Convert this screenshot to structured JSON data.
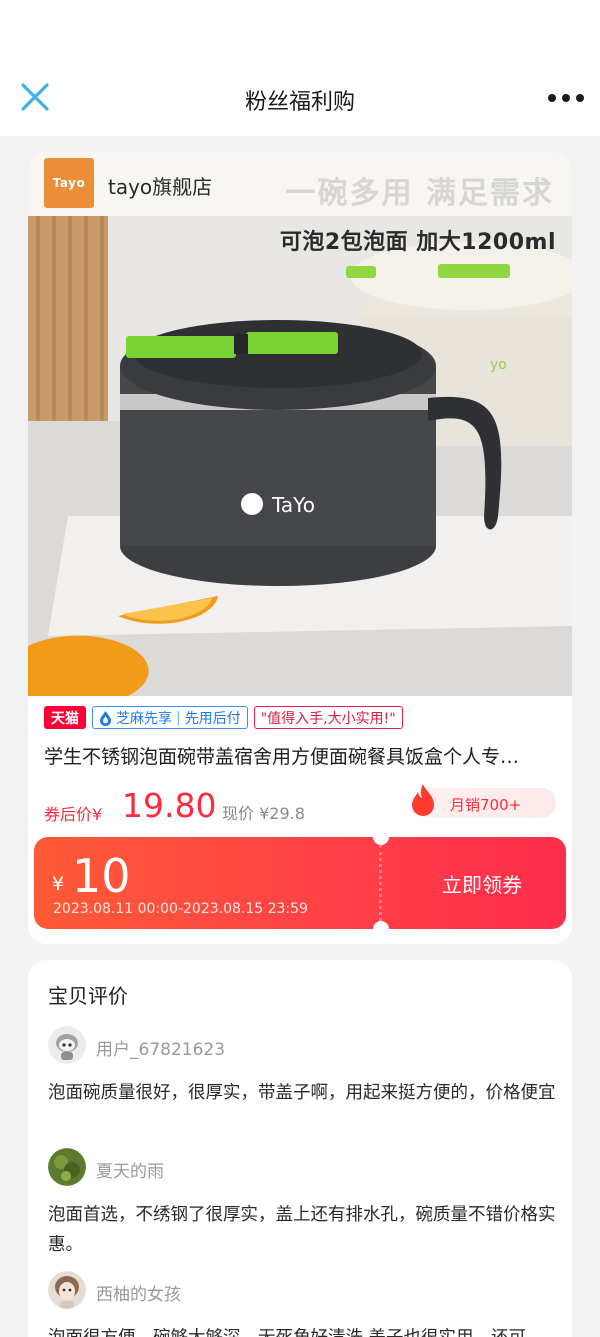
{
  "header": {
    "title": "粉丝福利购"
  },
  "store": {
    "badge_text": "Tayo",
    "name": "tayo旗舰店"
  },
  "hero": {
    "slogan": "一碗多用 满足需求",
    "headline": "可泡2包泡面 加大1200ml",
    "product_logo": "TaYo"
  },
  "badges": {
    "tmall": "天猫",
    "zhima": "芝麻先享",
    "pay_later": "先用后付",
    "quote": "\"值得入手,大小实用!\""
  },
  "product": {
    "title": "学生不锈钢泡面碗带盖宿舍用方便面碗餐具饭盒个人专…",
    "price_label": "券后价",
    "price_currency": "¥",
    "price": "19.80",
    "original_price": "现价 ¥29.8",
    "monthly_sales": "月销700+"
  },
  "coupon": {
    "currency": "¥",
    "amount": "10",
    "validity": "2023.08.11 00:00-2023.08.15 23:59",
    "claim_label": "立即领券"
  },
  "reviews": {
    "heading": "宝贝评价",
    "items": [
      {
        "user": "用户_67821623",
        "text": "泡面碗质量很好，很厚实，带盖子啊，用起来挺方便的，价格便宜"
      },
      {
        "user": "夏天的雨",
        "text": "泡面首选，不绣钢了很厚实，盖上还有排水孔，碗质量不错价格实惠。"
      },
      {
        "user": "西柚的女孩",
        "text": "泡面很方便，碗够大够深，无死角好清洗,盖子也很实用，还可"
      }
    ]
  },
  "colors": {
    "accent": "#ff2a3e",
    "tmall": "#ff0036",
    "zhima": "#1f7ae8",
    "close_icon": "#3fb0e5"
  },
  "icons": {
    "close": "close-icon",
    "more": "more-dots-icon",
    "flame": "flame-icon"
  }
}
